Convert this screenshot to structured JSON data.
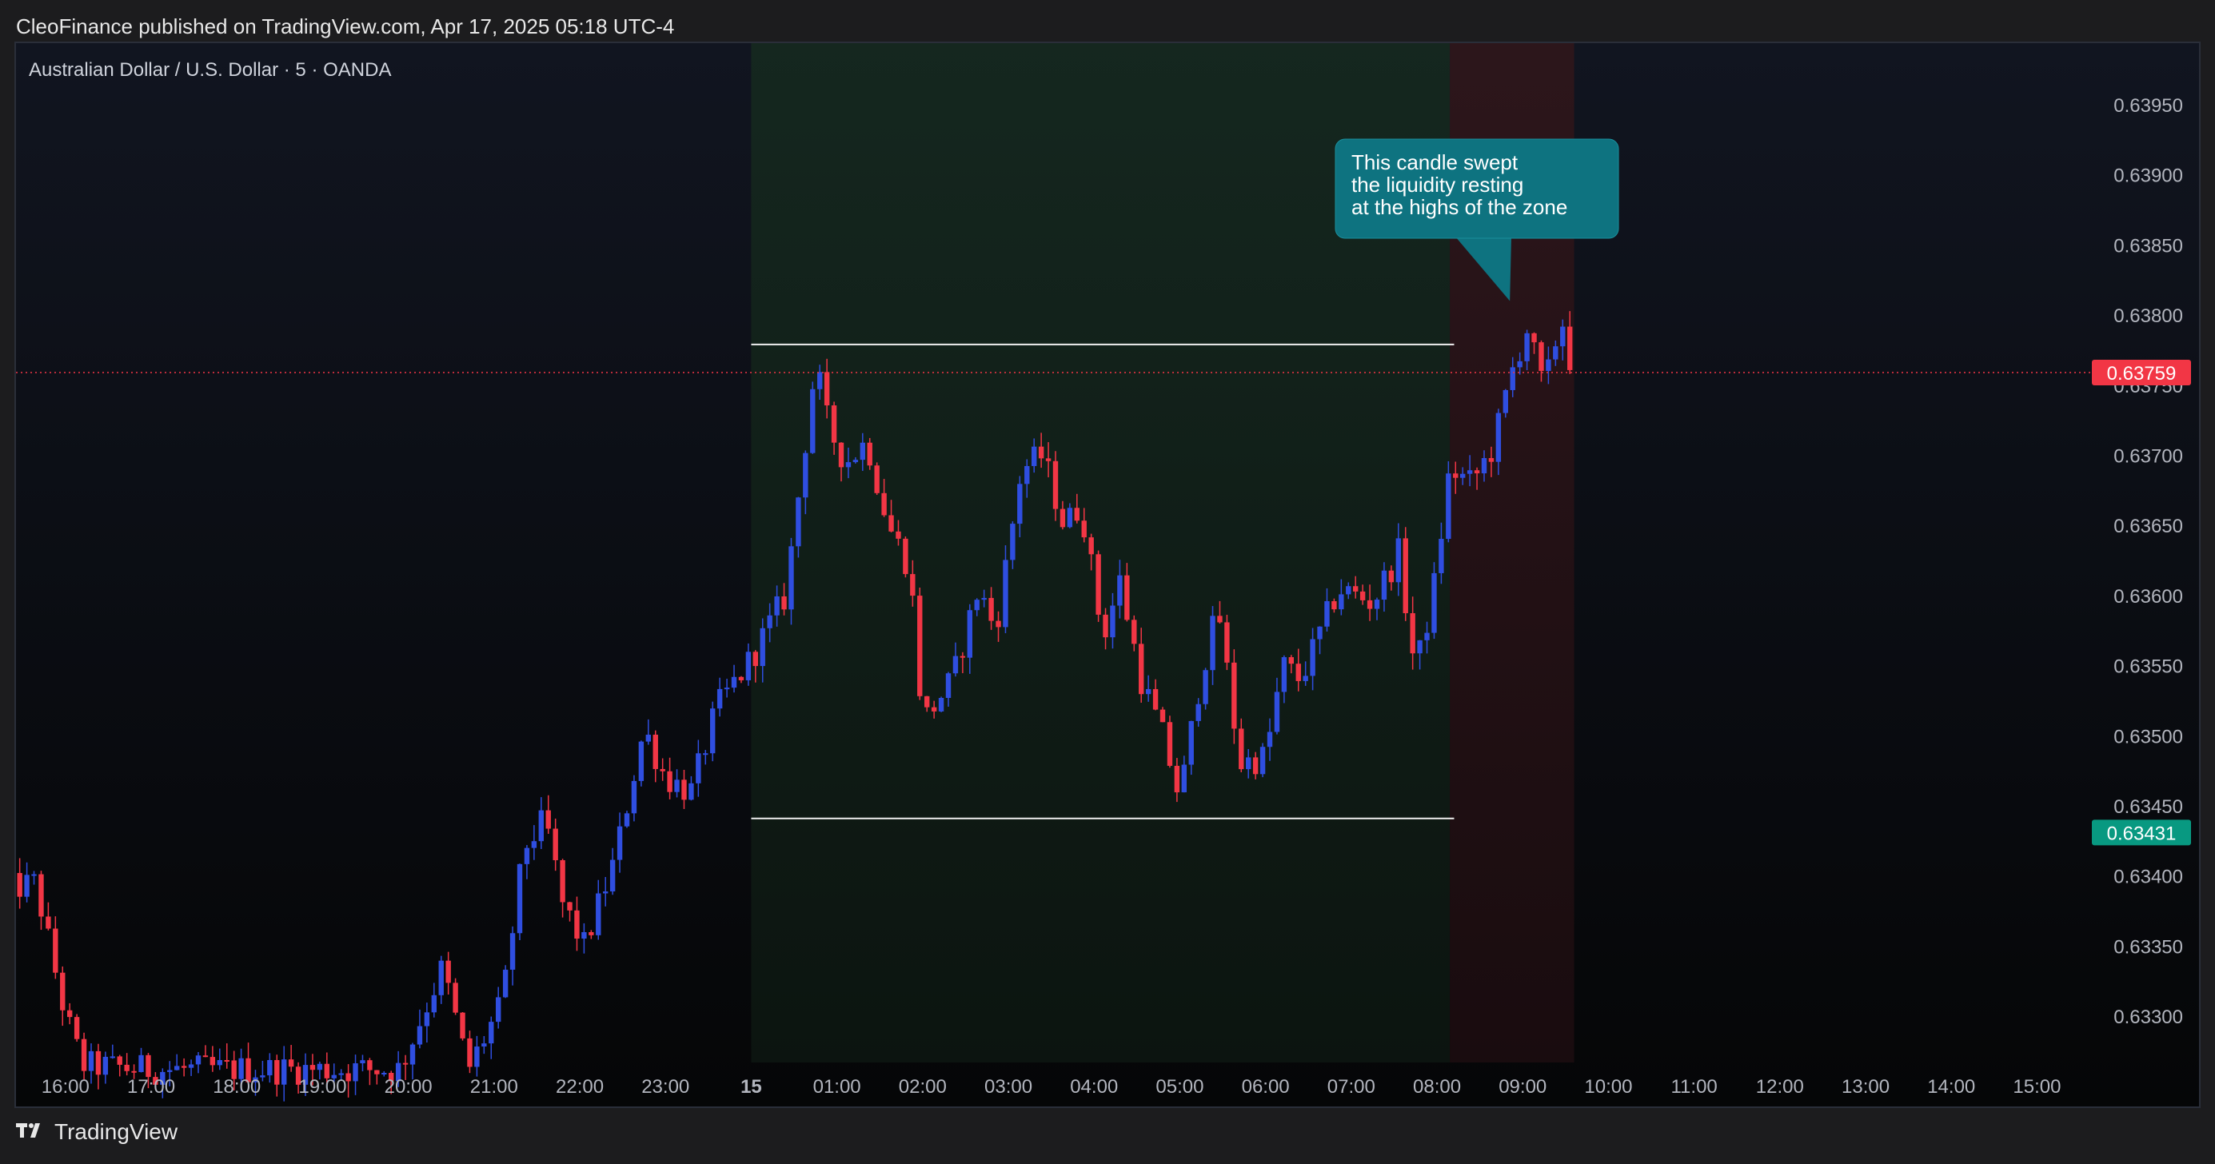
{
  "publisher_line": "CleoFinance published on TradingView.com, Apr 17, 2025 05:18 UTC-4",
  "footer": {
    "logo_icon": "tradingview-logo-icon",
    "brand": "TradingView"
  },
  "colors": {
    "up_candle": "#2f4ee0",
    "down_candle": "#f23645",
    "current_price_badge": "#f23645",
    "range_low_badge": "#089981",
    "annotation_bg": "#0e7380",
    "range_zone": "#102518",
    "sweep_zone": "#2a1216"
  },
  "chart_data": {
    "type": "candlestick",
    "title": "Australian Dollar / U.S. Dollar · 5 · OANDA",
    "y_axis": {
      "ticks": [
        "0.63950",
        "0.63900",
        "0.63850",
        "0.63800",
        "0.63750",
        "0.63700",
        "0.63650",
        "0.63600",
        "0.63550",
        "0.63500",
        "0.63450",
        "0.63400",
        "0.63350",
        "0.63300"
      ],
      "ylim": [
        0.6326,
        0.6399
      ]
    },
    "x_axis": {
      "ticks": [
        "16:00",
        "17:00",
        "18:00",
        "19:00",
        "20:00",
        "21:00",
        "22:00",
        "23:00",
        "15",
        "01:00",
        "02:00",
        "03:00",
        "04:00",
        "05:00",
        "06:00",
        "07:00",
        "08:00",
        "09:00",
        "10:00",
        "11:00",
        "12:00",
        "13:00",
        "14:00",
        "15:00"
      ],
      "xlim": [
        15.3,
        39.55
      ]
    },
    "price_labels": [
      {
        "value": "0.63759",
        "kind": "current"
      },
      {
        "value": "0.63431",
        "kind": "range-low"
      }
    ],
    "levels": [
      {
        "name": "range-high",
        "price": 0.63779,
        "x_start": 24.0,
        "x_end": 32.2
      },
      {
        "name": "range-low",
        "price": 0.63441,
        "x_start": 24.0,
        "x_end": 32.2
      }
    ],
    "zones": [
      {
        "name": "consolidation-zone",
        "x_start": 24.0,
        "x_end": 32.15
      },
      {
        "name": "sweep-zone",
        "x_start": 32.15,
        "x_end": 33.6
      }
    ],
    "annotation": {
      "lines": [
        "This candle swept",
        "the liquidity resting",
        "at the highs of the zone"
      ],
      "anchor_x": 32.85,
      "anchor_price": 0.6381
    },
    "segments": [
      {
        "t": 15.3,
        "p": 0.6339
      },
      {
        "t": 15.65,
        "p": 0.63395
      },
      {
        "t": 16.0,
        "p": 0.633
      },
      {
        "t": 16.2,
        "p": 0.63265
      },
      {
        "t": 17.0,
        "p": 0.63262
      },
      {
        "t": 19.9,
        "p": 0.63262
      },
      {
        "t": 20.4,
        "p": 0.63335
      },
      {
        "t": 20.7,
        "p": 0.63262
      },
      {
        "t": 21.1,
        "p": 0.6331
      },
      {
        "t": 21.35,
        "p": 0.6342
      },
      {
        "t": 21.6,
        "p": 0.6344
      },
      {
        "t": 21.8,
        "p": 0.6338
      },
      {
        "t": 22.05,
        "p": 0.6335
      },
      {
        "t": 22.4,
        "p": 0.6341
      },
      {
        "t": 22.75,
        "p": 0.63505
      },
      {
        "t": 23.0,
        "p": 0.6347
      },
      {
        "t": 23.3,
        "p": 0.6346
      },
      {
        "t": 23.6,
        "p": 0.6352
      },
      {
        "t": 24.0,
        "p": 0.63555
      },
      {
        "t": 24.4,
        "p": 0.636
      },
      {
        "t": 24.75,
        "p": 0.63765
      },
      {
        "t": 24.9,
        "p": 0.6372
      },
      {
        "t": 25.1,
        "p": 0.63695
      },
      {
        "t": 25.35,
        "p": 0.6371
      },
      {
        "t": 25.6,
        "p": 0.6365
      },
      {
        "t": 25.85,
        "p": 0.6362
      },
      {
        "t": 26.0,
        "p": 0.6351
      },
      {
        "t": 26.35,
        "p": 0.6354
      },
      {
        "t": 26.65,
        "p": 0.63605
      },
      {
        "t": 26.85,
        "p": 0.63575
      },
      {
        "t": 27.15,
        "p": 0.6369
      },
      {
        "t": 27.4,
        "p": 0.637
      },
      {
        "t": 27.65,
        "p": 0.6365
      },
      {
        "t": 27.85,
        "p": 0.63665
      },
      {
        "t": 28.1,
        "p": 0.6357
      },
      {
        "t": 28.3,
        "p": 0.6361
      },
      {
        "t": 28.55,
        "p": 0.6354
      },
      {
        "t": 28.8,
        "p": 0.635
      },
      {
        "t": 29.0,
        "p": 0.63455
      },
      {
        "t": 29.25,
        "p": 0.63545
      },
      {
        "t": 29.45,
        "p": 0.6359
      },
      {
        "t": 29.7,
        "p": 0.6348
      },
      {
        "t": 30.0,
        "p": 0.63485
      },
      {
        "t": 30.2,
        "p": 0.6355
      },
      {
        "t": 30.4,
        "p": 0.6354
      },
      {
        "t": 30.55,
        "p": 0.6356
      },
      {
        "t": 30.85,
        "p": 0.63605
      },
      {
        "t": 31.25,
        "p": 0.63595
      },
      {
        "t": 31.55,
        "p": 0.6363
      },
      {
        "t": 31.75,
        "p": 0.63545
      },
      {
        "t": 31.95,
        "p": 0.636
      },
      {
        "t": 32.15,
        "p": 0.6369
      },
      {
        "t": 32.4,
        "p": 0.6368
      },
      {
        "t": 32.65,
        "p": 0.63705
      },
      {
        "t": 32.9,
        "p": 0.63765
      },
      {
        "t": 33.05,
        "p": 0.6379
      },
      {
        "t": 33.25,
        "p": 0.63745
      },
      {
        "t": 33.45,
        "p": 0.638
      },
      {
        "t": 33.58,
        "p": 0.6376
      }
    ]
  }
}
